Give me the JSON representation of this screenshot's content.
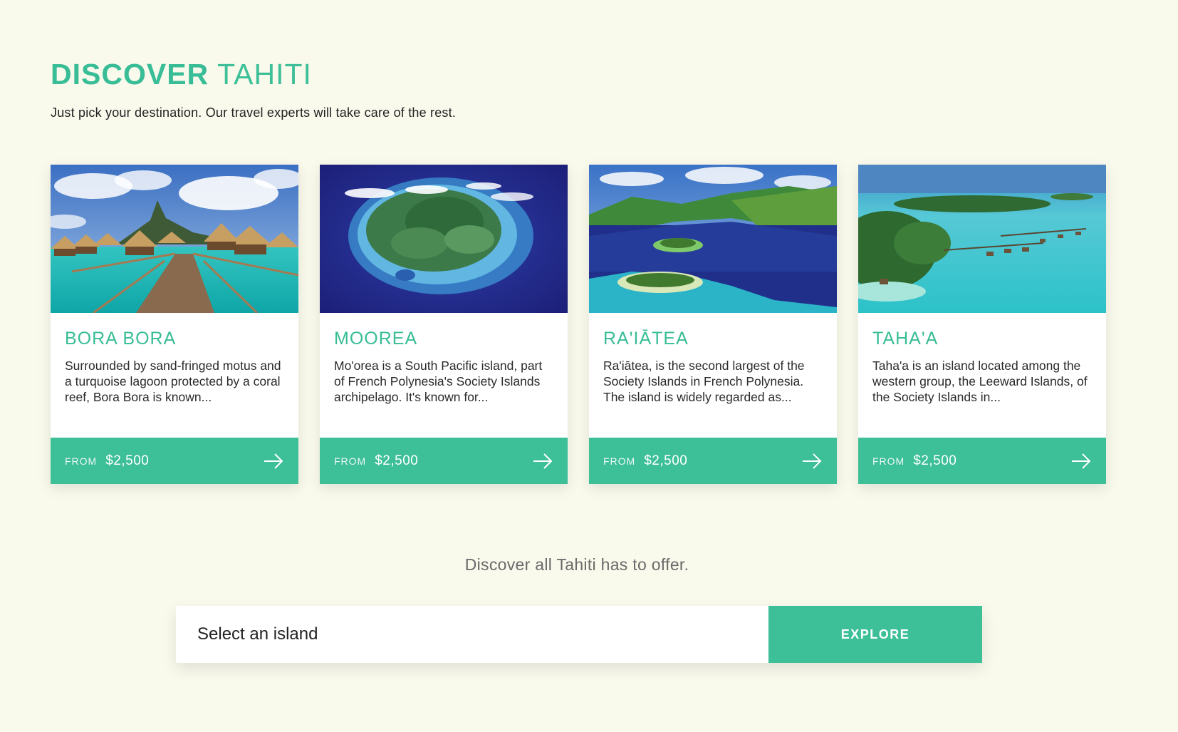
{
  "header": {
    "title_bold": "DISCOVER",
    "title_light": "TAHITI",
    "subtitle": "Just pick your destination. Our travel experts will take care of the rest."
  },
  "cards": [
    {
      "title": "BORA BORA",
      "description": "Surrounded by sand-fringed motus  and a turquoise lagoon protected by a coral reef, Bora Bora is known...",
      "from_label": "FROM",
      "price": "$2,500",
      "image": "overwater-bungalows-photo"
    },
    {
      "title": "MOOREA",
      "description": "Mo'orea is a South Pacific island, part of French Polynesia's Society Islands archipelago. It's known for...",
      "from_label": "FROM",
      "price": "$2,500",
      "image": "aerial-island-photo"
    },
    {
      "title": "RA'IĀTEA",
      "description": "Ra'iātea, is the second largest of the Society Islands in French Polynesia. The island is widely regarded as...",
      "from_label": "FROM",
      "price": "$2,500",
      "image": "lagoon-bay-photo"
    },
    {
      "title": "TAHA'A",
      "description": "Taha'a is an island located among the western group, the Leeward Islands, of the Society Islands in...",
      "from_label": "FROM",
      "price": "$2,500",
      "image": "turquoise-lagoon-photo"
    }
  ],
  "discover_all": "Discover all Tahiti has to offer.",
  "search": {
    "select_label": "Select an island",
    "button_label": "EXPLORE"
  },
  "colors": {
    "accent": "#3dbf98",
    "background": "#f9f9ec"
  }
}
